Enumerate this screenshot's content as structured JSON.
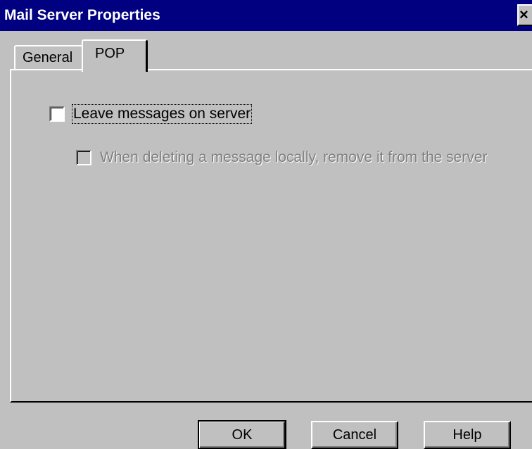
{
  "window": {
    "title": "Mail Server Properties",
    "close_glyph": "×"
  },
  "tabs": [
    {
      "label": "General",
      "active": false
    },
    {
      "label": "POP",
      "active": true
    }
  ],
  "pop": {
    "leave_messages": {
      "label": "Leave messages on server",
      "checked": false,
      "enabled": true
    },
    "remove_on_delete": {
      "label": "When deleting a message locally, remove it from the server",
      "checked": false,
      "enabled": false
    }
  },
  "buttons": {
    "ok": "OK",
    "cancel": "Cancel",
    "help": "Help"
  },
  "colors": {
    "titlebar": "#000080",
    "face": "#c0c0c0",
    "disabled_text": "#808080"
  }
}
